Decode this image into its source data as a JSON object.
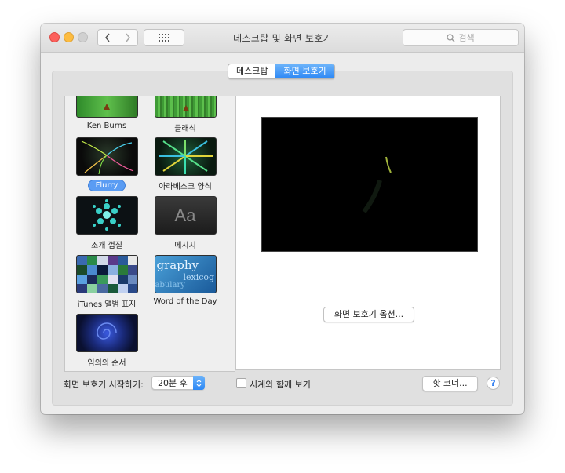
{
  "window": {
    "title": "데스크탑 및 화면 보호기"
  },
  "toolbar": {
    "search_placeholder": "검색"
  },
  "tabs": [
    {
      "label": "데스크탑",
      "active": false
    },
    {
      "label": "화면 보호기",
      "active": true
    }
  ],
  "screensavers": [
    {
      "label": "Ken Burns",
      "selected": false
    },
    {
      "label": "클래식",
      "selected": false
    },
    {
      "label": "Flurry",
      "selected": true
    },
    {
      "label": "아라베스크 양식",
      "selected": false
    },
    {
      "label": "조개 껍질",
      "selected": false
    },
    {
      "label": "메시지",
      "selected": false
    },
    {
      "label": "iTunes 앨범 표지",
      "selected": false
    },
    {
      "label": "Word of the Day",
      "selected": false
    },
    {
      "label": "임의의 순서",
      "selected": false
    }
  ],
  "thumb_text": {
    "message": "Aa",
    "word_line1": "graphy",
    "word_line2": "lexicog",
    "word_line3": "abulary"
  },
  "preview": {
    "options_button": "화면 보호기 옵션..."
  },
  "bottom": {
    "start_label": "화면 보호기 시작하기:",
    "start_value": "20분 후",
    "clock_label": "시계와 함께 보기",
    "clock_checked": false,
    "hot_corners": "핫 코너...",
    "help": "?"
  },
  "colors": {
    "accent": "#2d88f5",
    "close": "#fc605c",
    "minimize": "#fdbc40"
  }
}
